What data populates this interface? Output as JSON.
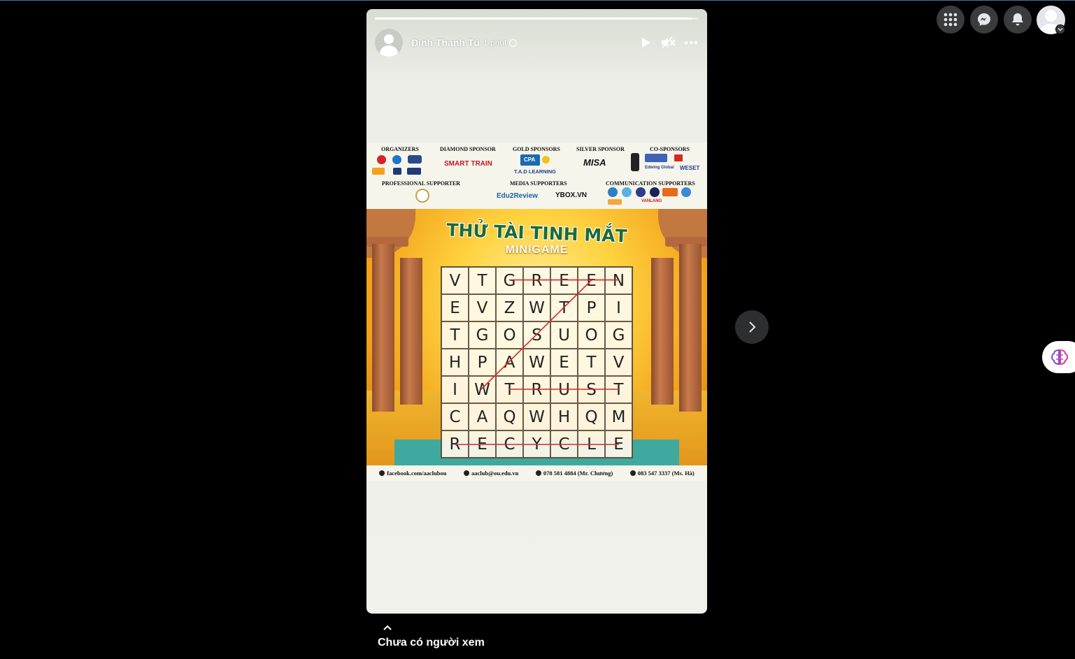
{
  "header": {
    "menu_icon": "grid-menu-icon",
    "messenger_icon": "messenger-icon",
    "notifications_icon": "bell-icon",
    "account_icon": "profile-avatar"
  },
  "story": {
    "author": "Đinh Thanh Tú",
    "time": "1 phút",
    "privacy_icon": "globe-icon",
    "progress": 0.98,
    "controls": [
      "play-icon",
      "mute-icon",
      "more-icon"
    ]
  },
  "image": {
    "sponsors": {
      "organizers": "ORGANIZERS",
      "diamond": "DIAMOND SPONSOR",
      "gold": "GOLD SPONSORS",
      "silver": "SILVER SPONSOR",
      "co": "CO-SPONSORS",
      "professional": "PROFESSIONAL SUPPORTER",
      "media": "MEDIA SUPPORTERS",
      "communication": "COMMUNICATION SUPPORTERS",
      "smarttrain": "SMART TRAIN",
      "cpa": "CPA",
      "tad": "T.A.D LEARNING",
      "misa": "MISA",
      "edu2review": "Edu2Review",
      "ybox": "YBOX.VN",
      "edwing": "Edwing Global",
      "weset": "WESET",
      "vanlang": "VANLANG"
    },
    "title": "THỬ TÀI TINH MẮT",
    "subtitle": "MINIGAME",
    "grid": [
      [
        "V",
        "T",
        "G",
        "R",
        "E",
        "E",
        "N"
      ],
      [
        "E",
        "V",
        "Z",
        "W",
        "T",
        "P",
        "I"
      ],
      [
        "T",
        "G",
        "O",
        "S",
        "U",
        "O",
        "G"
      ],
      [
        "H",
        "P",
        "A",
        "W",
        "E",
        "T",
        "V"
      ],
      [
        "I",
        "W",
        "T",
        "R",
        "U",
        "S",
        "T"
      ],
      [
        "C",
        "A",
        "Q",
        "W",
        "H",
        "Q",
        "M"
      ],
      [
        "R",
        "E",
        "C",
        "Y",
        "C",
        "L",
        "E"
      ]
    ],
    "contacts": {
      "facebook": "facebook.com/aaclubou",
      "email": "aaclub@ou.edu.vn",
      "phone1": "078 581 4884 (Mr. Chương)",
      "phone2": "083 547 3337 (Ms. Hà)"
    }
  },
  "nav": {
    "next_icon": "chevron-right-icon",
    "extension_icon": "brain-icon"
  },
  "viewers": {
    "caret_icon": "chevron-up-icon",
    "label": "Chưa có người xem"
  }
}
